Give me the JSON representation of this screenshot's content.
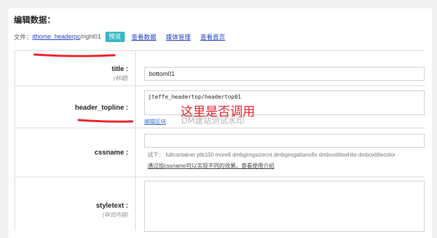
{
  "page": {
    "title": "编辑数据：",
    "file_label": "文件：",
    "file_link": "jthome_headerpc",
    "file_suffix": "/right01",
    "preview_label": "预览",
    "links": [
      "查看数据",
      "媒体管理",
      "查看首页"
    ]
  },
  "form": {
    "title": {
      "label": "title :",
      "sub": "(标题)",
      "value": "bottom01"
    },
    "header_topline": {
      "label": "header_topline :",
      "value": "jteffe_headertop/headertop01",
      "edit_link": "编辑区块"
    },
    "cssname": {
      "label": "cssname :",
      "value": "",
      "hint": "试下：  fullcontainer ptb100 more6 dmbgimgsizecnt dmbgimgattanofix dmboxtitlewhite dmboxtitlecolor",
      "hint_link": "通过加cssname可以实现不同的效果。查看使用介绍"
    },
    "styletext": {
      "label": "styletext :",
      "sub": "(样式内容)",
      "value": ""
    }
  },
  "annotations": {
    "red_note": "这里是否调用",
    "watermark": "DM建站测试水印",
    "color": "#e8202a"
  }
}
